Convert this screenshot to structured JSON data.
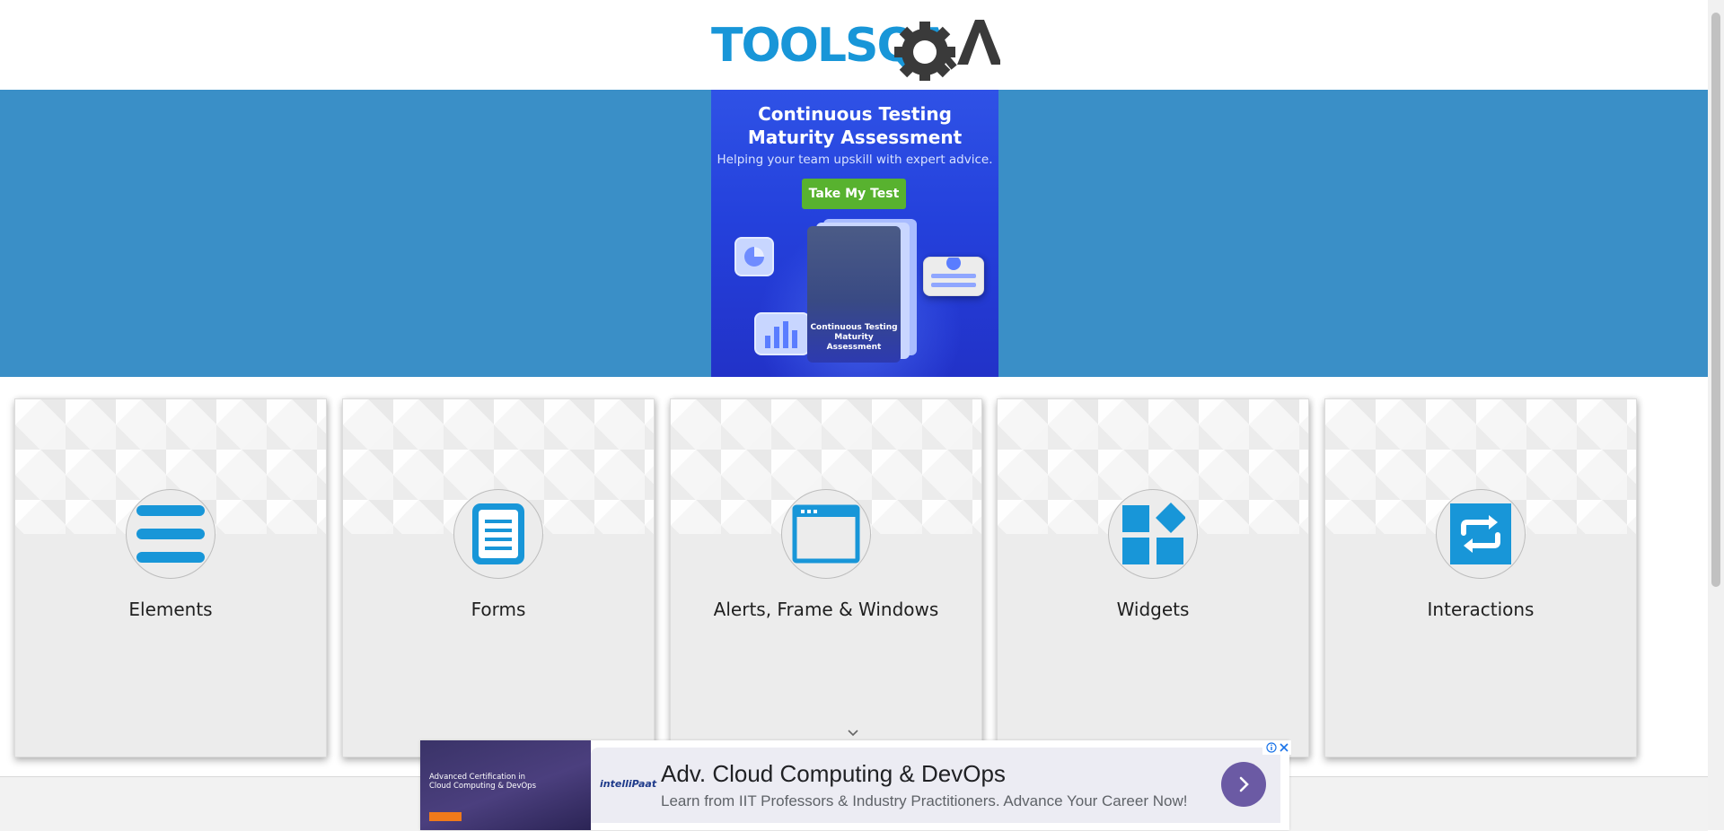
{
  "header": {
    "logo_text": "TOOLSQA",
    "logo_colors": {
      "tools": "#1896d8",
      "qa": "#3a3a3a"
    }
  },
  "banner": {
    "background": "#3a8fc7",
    "ad": {
      "title": "Continuous Testing\nMaturity Assessment",
      "subtitle": "Helping your team upskill with expert advice.",
      "button_label": "Take My Test",
      "button_color": "#58b22f",
      "book_text": "Continuous Testing\nMaturity Assessment"
    }
  },
  "categories": [
    {
      "title": "Elements",
      "icon": "hamburger-lines-icon"
    },
    {
      "title": "Forms",
      "icon": "document-list-icon"
    },
    {
      "title": "Alerts, Frame & Windows",
      "icon": "browser-window-icon"
    },
    {
      "title": "Widgets",
      "icon": "widgets-grid-icon"
    },
    {
      "title": "Interactions",
      "icon": "repeat-arrows-icon"
    }
  ],
  "accent_color": "#1896d8",
  "bottom_ad": {
    "image_title": "Advanced Certification in\nCloud Computing & DevOps",
    "brand": "intelliPaat",
    "headline": "Adv. Cloud Computing & DevOps",
    "description": "Learn from IIT Professors & Industry Practitioners. Advance Your Career Now!",
    "arrow_icon": "chevron-right-icon",
    "arrow_color": "#6b5aa4"
  }
}
